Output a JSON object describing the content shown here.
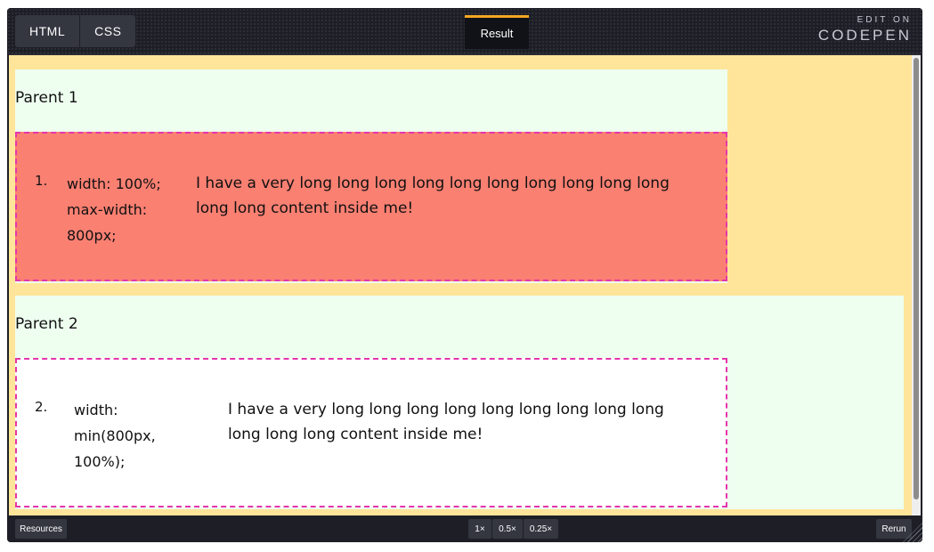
{
  "toolbar": {
    "tabs": [
      {
        "label": "HTML"
      },
      {
        "label": "CSS"
      }
    ],
    "result_tab": "Result",
    "edit_on": "EDIT ON",
    "brand": "CODEPEN"
  },
  "result": {
    "parents": [
      {
        "title": "Parent 1",
        "child": {
          "number": "1.",
          "css_lines": [
            "width: 100%;",
            "max-width:",
            "800px;"
          ],
          "content_lines": [
            "I have a very long long long long long long long long long long",
            "long long content inside me!"
          ]
        }
      },
      {
        "title": "Parent 2",
        "child": {
          "number": "2.",
          "css_lines": [
            "width:",
            "min(800px,",
            "100%);"
          ],
          "content_lines": [
            "I have a very long long long long long long long long long",
            "long long long content inside me!"
          ]
        }
      }
    ]
  },
  "bottom_bar": {
    "resources": "Resources",
    "zoom_options": [
      "1×",
      "0.5×",
      "0.25×"
    ],
    "rerun": "Rerun"
  },
  "colors": {
    "viewport_bg": "#ffe599",
    "parent_bg": "#eefff0",
    "child1_bg": "#fa8072",
    "child2_bg": "#ffffff",
    "dashed_border": "#e535ab",
    "accent": "#f5a623"
  }
}
